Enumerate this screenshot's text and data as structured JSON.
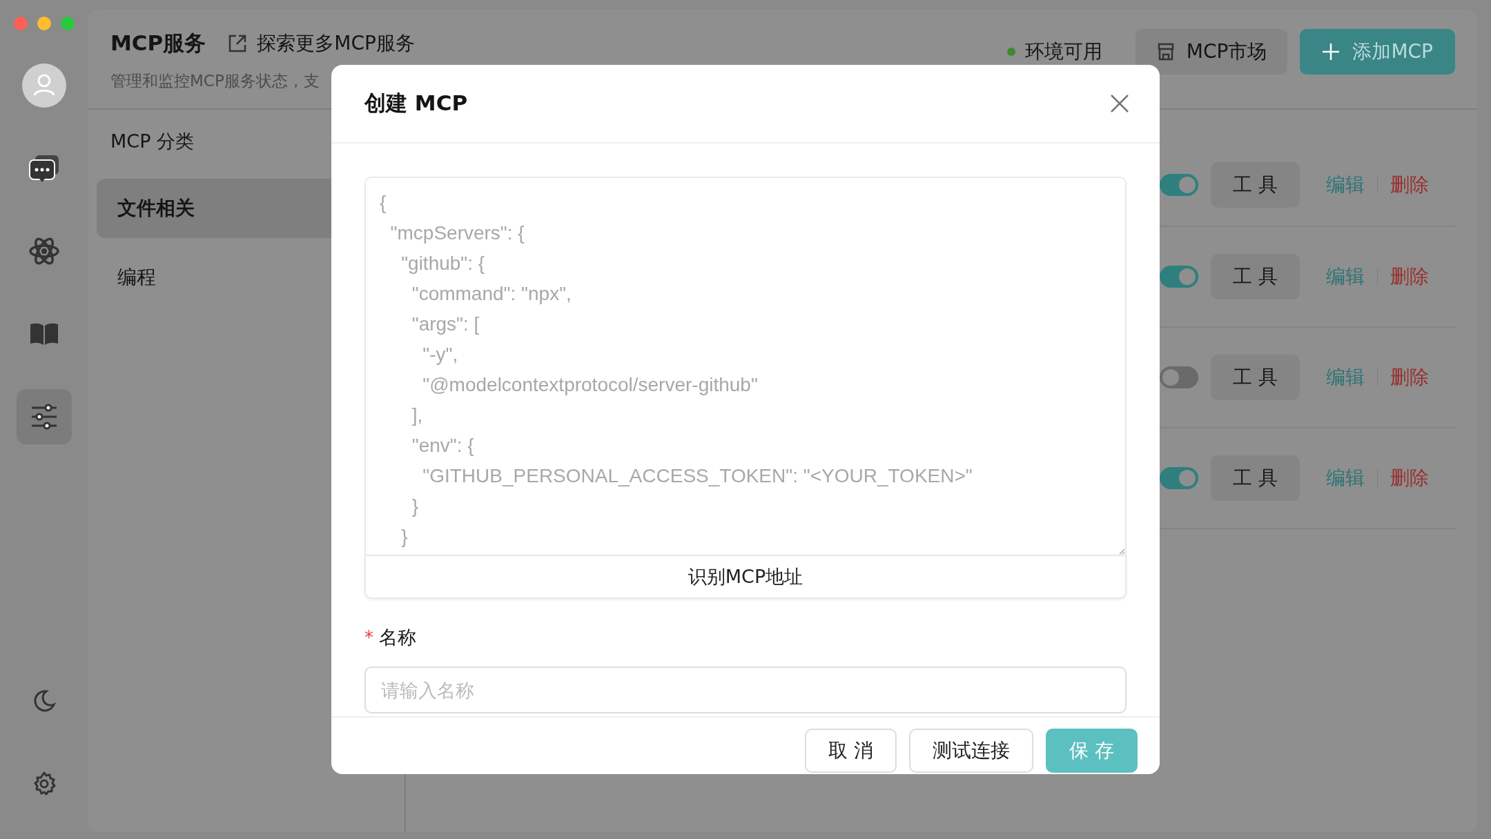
{
  "window_controls": [
    {
      "kind": "close"
    },
    {
      "kind": "minimize"
    },
    {
      "kind": "zoom"
    }
  ],
  "dock": [
    {
      "kind": "avatar",
      "selected": false
    },
    {
      "kind": "chat",
      "selected": false
    },
    {
      "kind": "atom",
      "selected": false
    },
    {
      "kind": "book",
      "selected": false
    },
    {
      "kind": "sliders",
      "selected": true
    },
    {
      "kind": "moon",
      "selected": false
    },
    {
      "kind": "gear",
      "selected": false
    }
  ],
  "header": {
    "title": "MCP服务",
    "explore_link": "探索更多MCP服务",
    "subtitle": "管理和监控MCP服务状态，支",
    "status": {
      "label": "环境可用",
      "color": "#3e8a2c"
    },
    "market_button": "MCP市场",
    "add_button": "添加MCP"
  },
  "categories": {
    "title": "MCP 分类",
    "items": [
      {
        "label": "文件相关",
        "selected": true
      },
      {
        "label": "编程",
        "selected": false
      }
    ]
  },
  "servers": [
    {
      "enabled": true,
      "tools": "工 具",
      "edit": "编辑",
      "delete": "删除"
    },
    {
      "enabled": true,
      "tools": "工 具",
      "edit": "编辑",
      "delete": "删除"
    },
    {
      "enabled": false,
      "tools": "工 具",
      "edit": "编辑",
      "delete": "删除"
    },
    {
      "enabled": true,
      "tools": "工 具",
      "edit": "编辑",
      "delete": "删除"
    }
  ],
  "dialog": {
    "title": "创建 MCP",
    "config": {
      "placeholder": "{\n  \"mcpServers\": {\n    \"github\": {\n      \"command\": \"npx\",\n      \"args\": [\n        \"-y\",\n        \"@modelcontextprotocol/server-github\"\n      ],\n      \"env\": {\n        \"GITHUB_PERSONAL_ACCESS_TOKEN\": \"<YOUR_TOKEN>\"\n      }\n    }"
    },
    "parse_button": "识别MCP地址",
    "name_field": {
      "label": "名称",
      "required_mark": "*",
      "placeholder": "请输入名称"
    },
    "buttons": [
      {
        "label": "取 消",
        "kind": "default"
      },
      {
        "label": "测试连接",
        "kind": "default"
      },
      {
        "label": "保 存",
        "kind": "primary"
      }
    ]
  }
}
